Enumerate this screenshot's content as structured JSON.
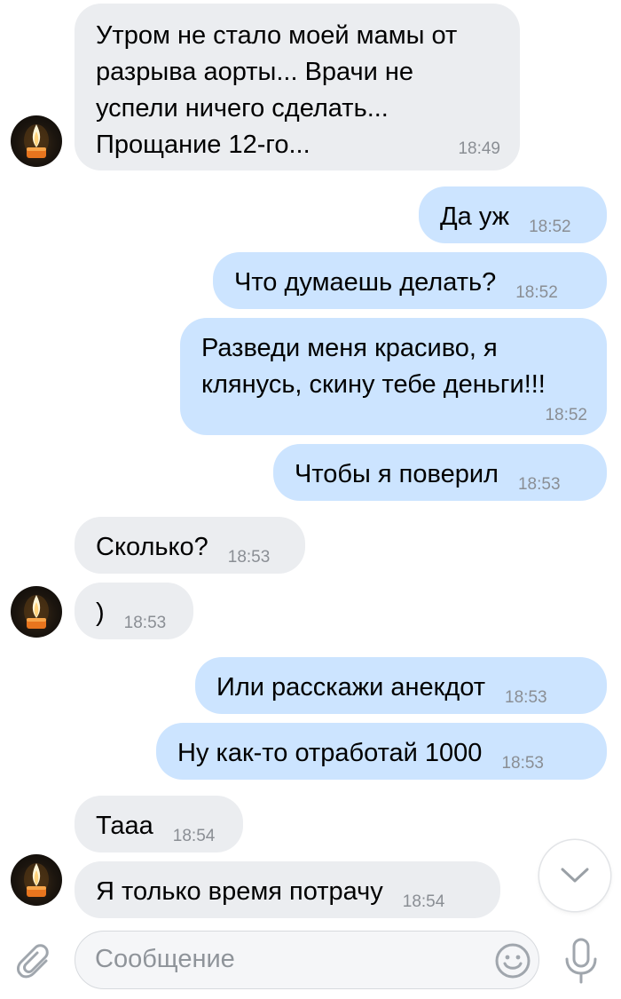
{
  "messages": [
    {
      "side": "in",
      "text": "Утром не стало моей мамы от\nразрыва аорты... Врачи не\nуспели ничего сделать...\nПрощание 12-го...",
      "time": "18:49"
    },
    {
      "side": "out",
      "text": "Да уж",
      "time": "18:52"
    },
    {
      "side": "out",
      "text": "Что думаешь делать?",
      "time": "18:52"
    },
    {
      "side": "out",
      "text": "Разведи меня красиво, я\nклянусь, скину тебе деньги!!!",
      "time": "18:52"
    },
    {
      "side": "out",
      "text": "Чтобы я поверил",
      "time": "18:53"
    },
    {
      "side": "in",
      "text": "Сколько?",
      "time": "18:53"
    },
    {
      "side": "in",
      "text": ")",
      "time": "18:53"
    },
    {
      "side": "out",
      "text": "Или расскажи анекдот",
      "time": "18:53"
    },
    {
      "side": "out",
      "text": "Ну как-то отработай 1000",
      "time": "18:53"
    },
    {
      "side": "in",
      "text": "Тааа",
      "time": "18:54"
    },
    {
      "side": "in",
      "text": "Я только время потрачу",
      "time": "18:54"
    }
  ],
  "composer": {
    "placeholder": "Сообщение"
  },
  "icons": {
    "attach": "paperclip-icon",
    "emoji": "smiley-icon",
    "mic": "microphone-icon",
    "scroll": "chevron-down-icon",
    "avatar": "candle-avatar"
  },
  "colors": {
    "incoming_bubble": "#ebedf0",
    "outgoing_bubble": "#cce4ff",
    "time_text": "#8a8e94",
    "icon_gray": "#a0a6ad"
  }
}
